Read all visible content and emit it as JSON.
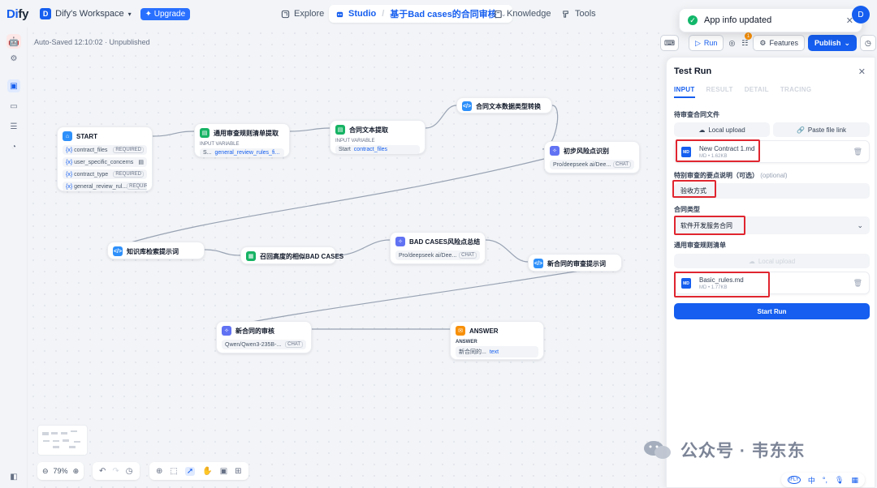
{
  "header": {
    "logo_prefix": "Di",
    "logo_suffix": "fy",
    "workspace_initial": "D",
    "workspace_name": "Dify's Workspace",
    "upgrade_label": "Upgrade",
    "nav": {
      "explore": "Explore",
      "studio": "Studio",
      "app_name": "基于Bad cases的合同审核",
      "knowledge": "Knowledge",
      "tools": "Tools"
    },
    "user_initial": "D"
  },
  "toast": {
    "message": "App info updated"
  },
  "canvas": {
    "autosave": "Auto-Saved 12:10:02 · Unpublished",
    "zoom": "79%"
  },
  "nodes": {
    "start": {
      "title": "START",
      "vars": [
        {
          "name": "contract_files",
          "tag": "REQUIRED"
        },
        {
          "name": "user_specific_concerns",
          "tag": ""
        },
        {
          "name": "contract_type",
          "tag": "REQUIRED"
        },
        {
          "name": "general_review_rul...",
          "tag": "REQUIRED"
        }
      ]
    },
    "rules_extract": {
      "title": "通用审查规则清单提取",
      "label": "INPUT VARIABLE",
      "var_src": "S...",
      "var": "general_review_rules_fi..."
    },
    "contract_extract": {
      "title": "合同文本提取",
      "label": "INPUT VARIABLE",
      "var_src": "Start",
      "var": "contract_files"
    },
    "type_convert": {
      "title": "合同文本数据类型转换"
    },
    "risk_identify": {
      "title": "初步风险点识别",
      "model": "Pro/deepseek ai/Dee...",
      "tag": "CHAT"
    },
    "kb_prompt": {
      "title": "知识库检索提示词"
    },
    "retrieve_bad": {
      "title": "召回高度的相似BAD CASES"
    },
    "bad_summary": {
      "title": "BAD CASES风险点总结",
      "model": "Pro/deepseek ai/Dee...",
      "tag": "CHAT"
    },
    "new_prompt": {
      "title": "新合同的审查提示词"
    },
    "new_review": {
      "title": "新合同的审核",
      "model": "Qwen/Qwen3-235B-...",
      "tag": "CHAT"
    },
    "answer": {
      "title": "ANSWER",
      "label": "ANSWER",
      "src": "新合同的...",
      "var": "text"
    }
  },
  "actions": {
    "run": "Run",
    "features": "Features",
    "publish": "Publish",
    "features_badge": "1"
  },
  "panel": {
    "title": "Test Run",
    "tabs": [
      "INPUT",
      "RESULT",
      "DETAIL",
      "TRACING"
    ],
    "field1_label": "待审查合同文件",
    "local_upload": "Local upload",
    "paste_link": "Paste file link",
    "file1": {
      "name": "New Contract 1.md",
      "meta": "MD • 1.62KB",
      "type": "MD"
    },
    "field2_label": "特别审查的要点说明（可选）",
    "field2_optional": "(optional)",
    "field2_value": "验收方式",
    "field3_label": "合同类型",
    "field3_value": "软件开发服务合同",
    "field4_label": "通用审查规则清单",
    "local_upload2": "Local upload",
    "file2": {
      "name": "Basic_rules.md",
      "meta": "MD • 1.77KB",
      "type": "MD"
    },
    "start_run": "Start Run"
  },
  "watermark": {
    "text": "公众号 · 韦东东"
  },
  "ime_bar": {
    "lang": "中"
  }
}
